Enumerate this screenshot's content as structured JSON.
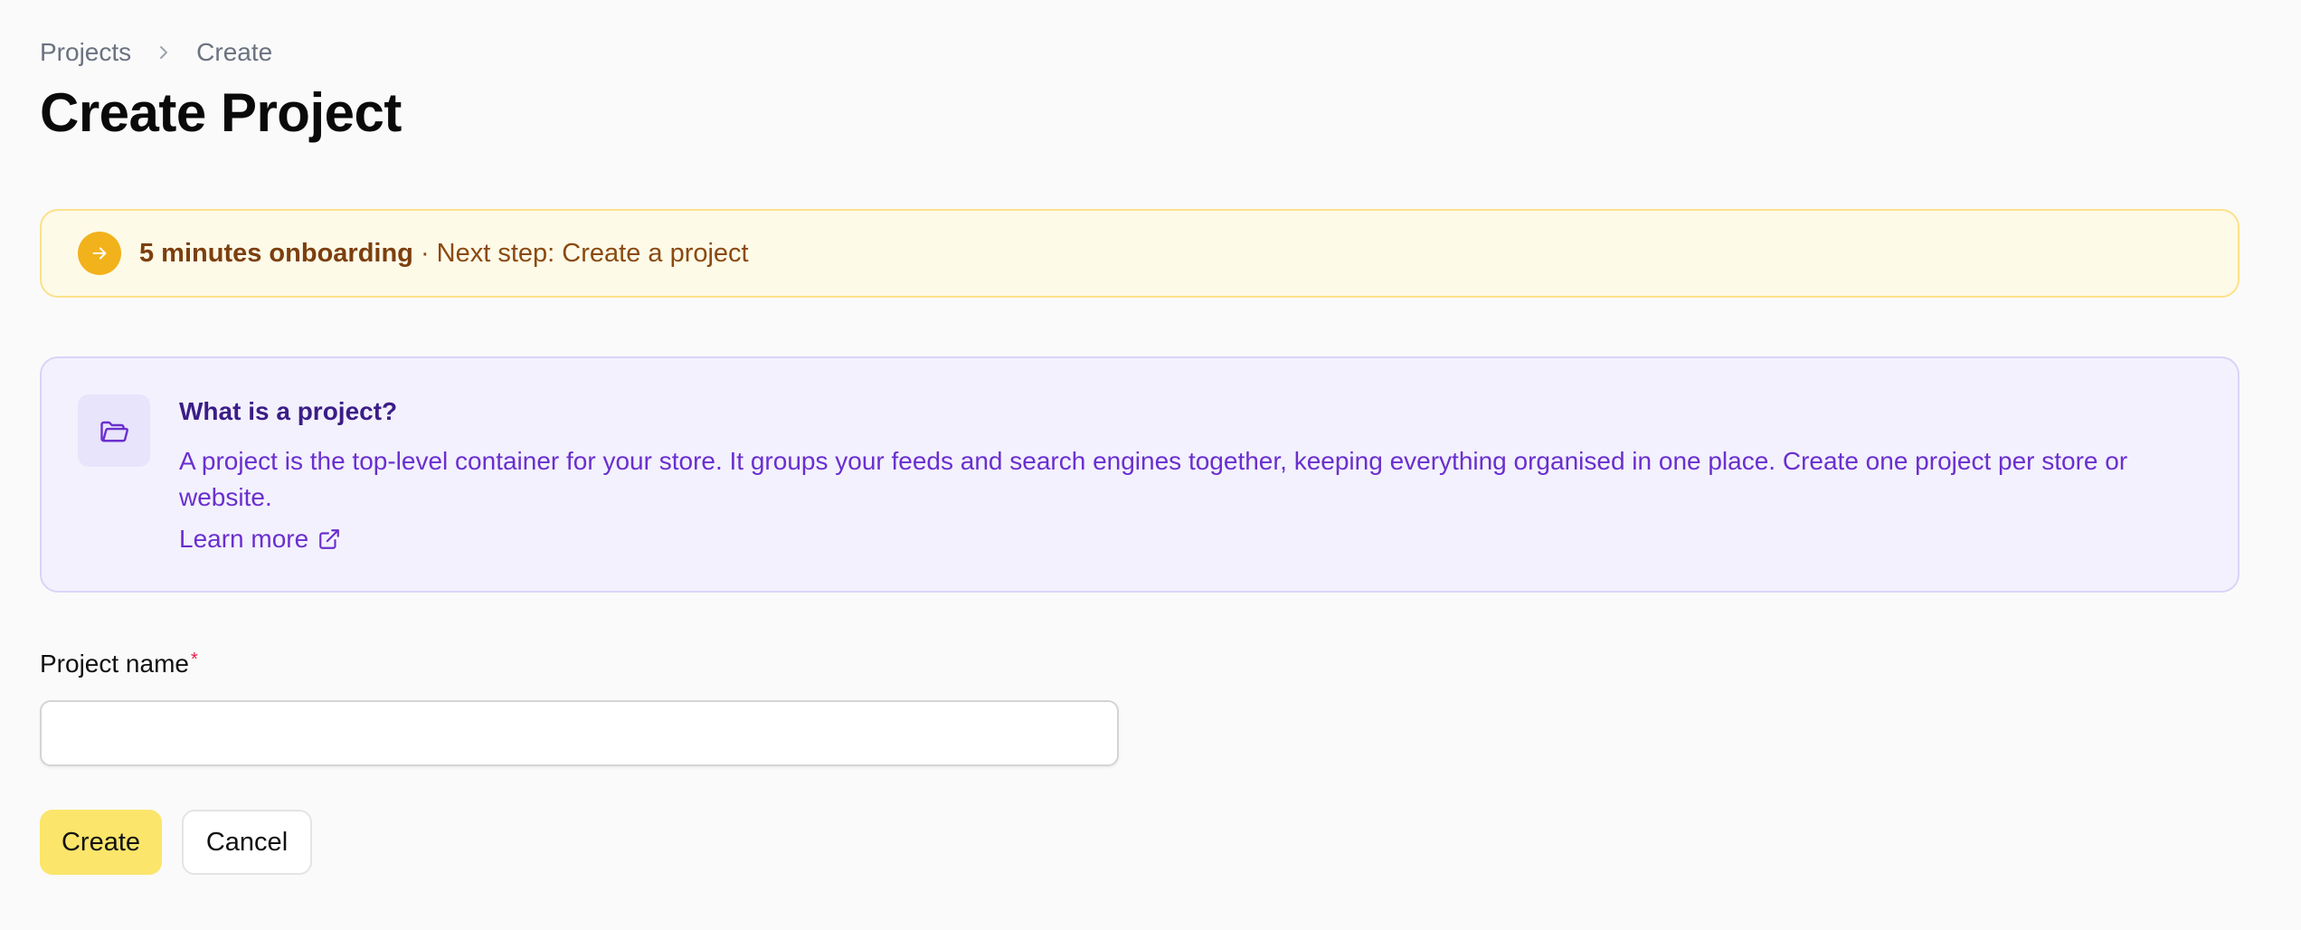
{
  "breadcrumb": {
    "items": [
      "Projects",
      "Create"
    ]
  },
  "page": {
    "title": "Create Project"
  },
  "onboarding": {
    "bold_text": "5 minutes onboarding",
    "rest_text": " · Next step: Create a project",
    "icon": "arrow-right-icon",
    "accent_color": "#f2b21b"
  },
  "info": {
    "icon": "folder-open-icon",
    "heading": "What is a project?",
    "description": "A project is the top-level container for your store. It groups your feeds and search engines together, keeping everything organised in one place. Create one project per store or website.",
    "link_label": "Learn more",
    "link_icon": "external-link-icon"
  },
  "form": {
    "project_name_label": "Project name",
    "required_marker": "*",
    "project_name_value": "",
    "create_label": "Create",
    "cancel_label": "Cancel"
  },
  "colors": {
    "primary_button": "#fbe56a",
    "info_bg": "#f3f1fd",
    "banner_bg": "#fefae8"
  }
}
